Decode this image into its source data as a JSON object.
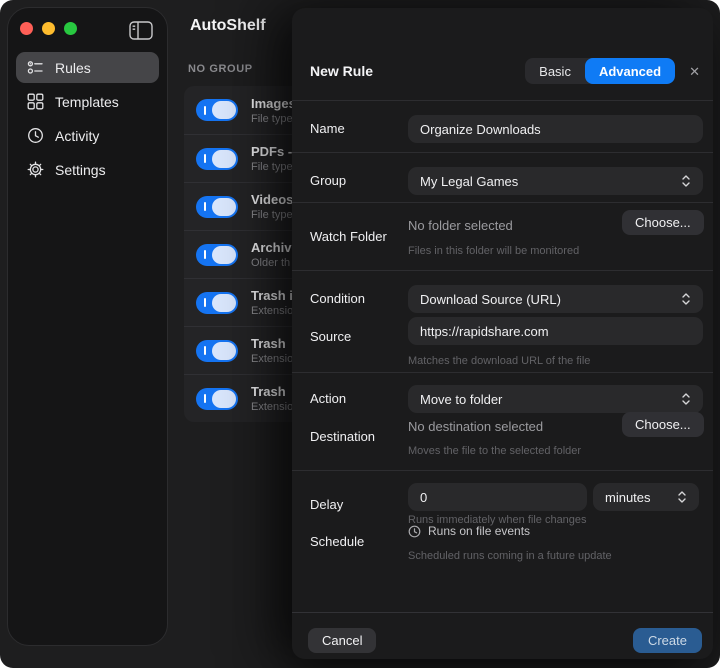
{
  "colors": {
    "accent_blue": "#0f7bf5",
    "toggle_blue": "#1574f2",
    "create_blue": "#2a5c92",
    "window_bg": "#1e1e1f",
    "sidebar_bg": "#151516",
    "modal_bg": "#1b1b1c",
    "field_bg": "#29292b",
    "divider": "#2d2d30",
    "list_bg": "#242426"
  },
  "sidebar": {
    "items": [
      {
        "label": "Rules",
        "icon": "rules-icon",
        "selected": true
      },
      {
        "label": "Templates",
        "icon": "templates-icon",
        "selected": false
      },
      {
        "label": "Activity",
        "icon": "activity-icon",
        "selected": false
      },
      {
        "label": "Settings",
        "icon": "settings-icon",
        "selected": false
      }
    ]
  },
  "main": {
    "app_title": "AutoShelf",
    "section_header": "NO GROUP",
    "rules": [
      {
        "title": "Images",
        "subtitle": "File type",
        "enabled": true
      },
      {
        "title": "PDFs -",
        "subtitle": "File type",
        "enabled": true
      },
      {
        "title": "Videos",
        "subtitle": "File type",
        "enabled": true
      },
      {
        "title": "Archiv",
        "subtitle": "Older th",
        "enabled": true
      },
      {
        "title": "Trash i",
        "subtitle": "Extensio",
        "enabled": true
      },
      {
        "title": "Trash",
        "subtitle": "Extensio",
        "enabled": true
      },
      {
        "title": "Trash",
        "subtitle": "Extensio",
        "enabled": true
      }
    ]
  },
  "modal": {
    "title": "New Rule",
    "segmented": {
      "basic": "Basic",
      "advanced": "Advanced",
      "selected": "Advanced"
    },
    "close_label": "✕",
    "name": {
      "label": "Name",
      "value": "Organize Downloads"
    },
    "group": {
      "label": "Group",
      "value": "My Legal Games"
    },
    "watch_folder": {
      "label": "Watch Folder",
      "value": "No folder selected",
      "button": "Choose...",
      "helper": "Files in this folder will be monitored"
    },
    "condition": {
      "label": "Condition",
      "value": "Download Source (URL)"
    },
    "source": {
      "label": "Source",
      "value": "https://rapidshare.com",
      "helper": "Matches the download URL of the file"
    },
    "action": {
      "label": "Action",
      "value": "Move to folder"
    },
    "destination": {
      "label": "Destination",
      "value": "No destination selected",
      "button": "Choose...",
      "helper": "Moves the file to the selected folder"
    },
    "delay": {
      "label": "Delay",
      "value": "0",
      "unit": "minutes",
      "helper": "Runs immediately when file changes"
    },
    "schedule": {
      "label": "Schedule",
      "status": "Runs on file events",
      "helper": "Scheduled runs coming in a future update"
    },
    "footer": {
      "cancel": "Cancel",
      "create": "Create"
    }
  }
}
